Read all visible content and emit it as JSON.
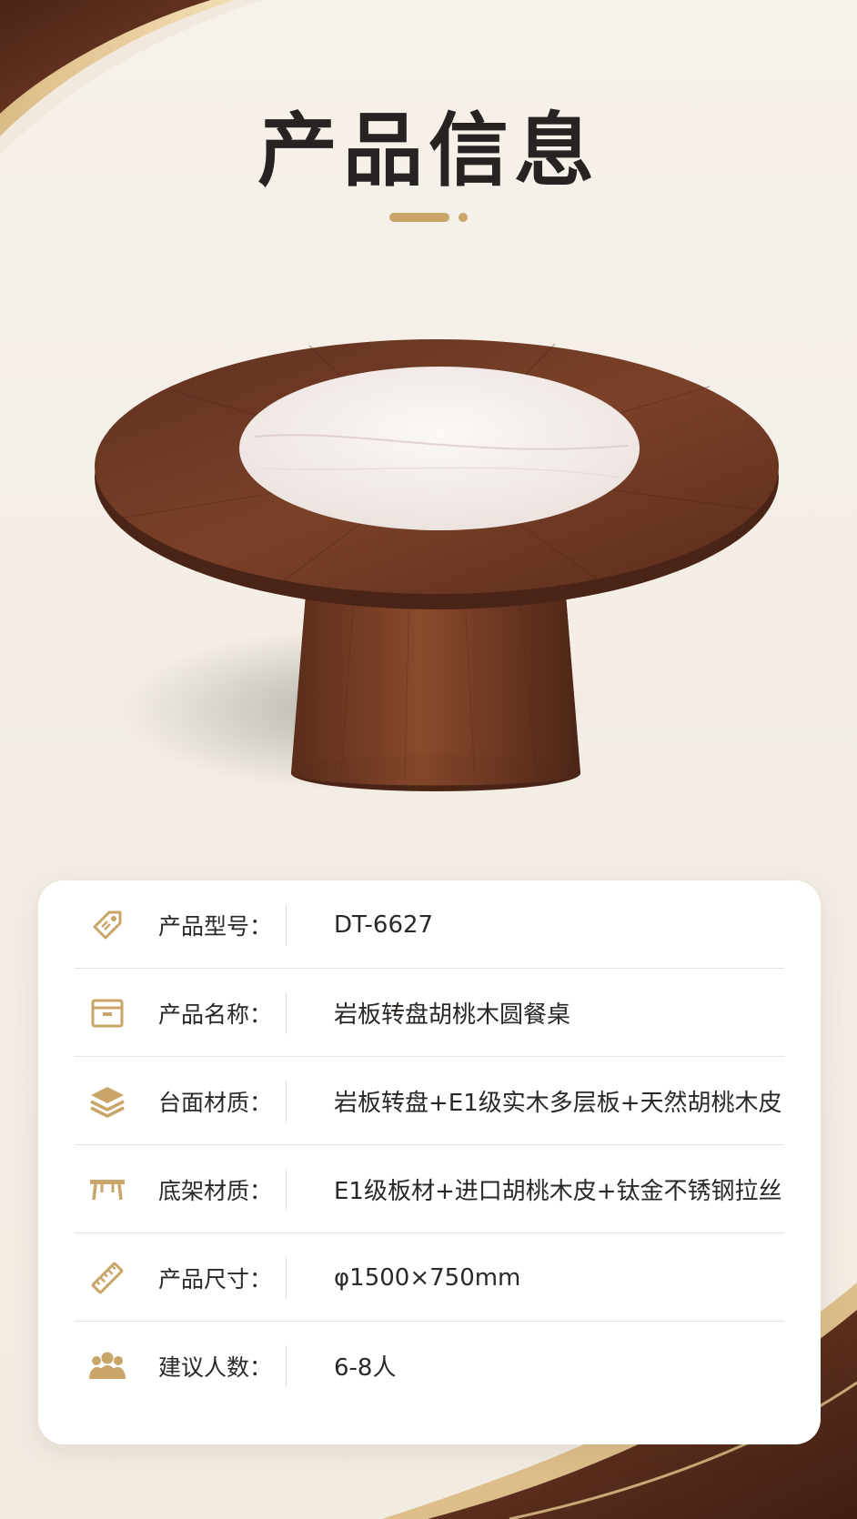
{
  "title": "产品信息",
  "colors": {
    "accent": "#c9a56a",
    "walnut": "#6e3b22",
    "text": "#2b2826"
  },
  "specs": [
    {
      "icon": "price-tag-icon",
      "label": "产品型号：",
      "value": "DT-6627"
    },
    {
      "icon": "box-icon",
      "label": "产品名称：",
      "value": "岩板转盘胡桃木圆餐桌"
    },
    {
      "icon": "layers-icon",
      "label": "台面材质：",
      "value": "岩板转盘+E1级实木多层板+天然胡桃木皮"
    },
    {
      "icon": "table-frame-icon",
      "label": "底架材质：",
      "value": "E1级板材+进口胡桃木皮+钛金不锈钢拉丝"
    },
    {
      "icon": "ruler-icon",
      "label": "产品尺寸：",
      "value": "φ1500×750mm"
    },
    {
      "icon": "people-icon",
      "label": "建议人数：",
      "value": "6-8人"
    }
  ]
}
